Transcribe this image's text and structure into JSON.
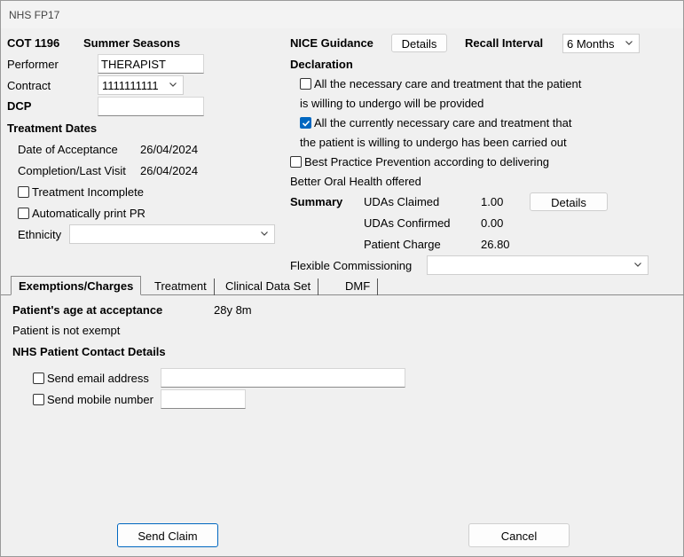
{
  "window": {
    "title": "NHS FP17"
  },
  "header": {
    "cot": "COT 1196",
    "practice": "Summer Seasons"
  },
  "left": {
    "performer_label": "Performer",
    "performer_value": "THERAPIST",
    "contract_label": "Contract",
    "contract_value": "1111111111",
    "dcp_label": "DCP",
    "dcp_value": "",
    "treatment_dates_heading": "Treatment Dates",
    "acceptance_label": "Date of Acceptance",
    "acceptance_value": "26/04/2024",
    "completion_label": "Completion/Last Visit",
    "completion_value": "26/04/2024",
    "treatment_incomplete_label": "Treatment Incomplete",
    "treatment_incomplete_checked": false,
    "auto_print_label": "Automatically print PR",
    "auto_print_checked": false,
    "ethnicity_label": "Ethnicity",
    "ethnicity_value": ""
  },
  "right": {
    "nice_label": "NICE Guidance",
    "nice_details_button": "Details",
    "recall_label": "Recall Interval",
    "recall_value": "6 Months",
    "declaration_heading": "Declaration",
    "decl1_line1": "All the necessary care and treatment that the patient",
    "decl1_line2": "is willing to undergo will be provided",
    "decl1_checked": false,
    "decl2_line1": "All the currently necessary care and treatment that",
    "decl2_line2": "the patient is willing to undergo has been carried out",
    "decl2_checked": true,
    "bpp_line1": "Best Practice Prevention according to delivering",
    "bpp_line2": "Better Oral Health offered",
    "bpp_checked": false,
    "summary_heading": "Summary",
    "udas_claimed_label": "UDAs Claimed",
    "udas_claimed_value": "1.00",
    "summary_details_button": "Details",
    "udas_confirmed_label": "UDAs Confirmed",
    "udas_confirmed_value": "0.00",
    "patient_charge_label": "Patient Charge",
    "patient_charge_value": "26.80",
    "flexible_label": "Flexible Commissioning",
    "flexible_value": ""
  },
  "tabs": [
    {
      "label": "Exemptions/Charges",
      "active": true
    },
    {
      "label": "Treatment",
      "active": false
    },
    {
      "label": "Clinical Data Set",
      "active": false
    },
    {
      "label": "DMF",
      "active": false
    }
  ],
  "exemptions": {
    "age_label": "Patient's age at acceptance",
    "age_value": "28y 8m",
    "exempt_status": "Patient is not exempt",
    "contact_heading": "NHS Patient Contact Details",
    "send_email_label": "Send email address",
    "send_email_checked": false,
    "email_value": "",
    "send_mobile_label": "Send mobile number",
    "send_mobile_checked": false,
    "mobile_value": ""
  },
  "footer": {
    "send_claim_button": "Send Claim",
    "cancel_button": "Cancel"
  },
  "colors": {
    "accent": "#0067c0",
    "window_bg": "#f0f0f0"
  },
  "icons": {
    "dropdown": "chevron-down-icon",
    "check": "checkmark-icon"
  }
}
